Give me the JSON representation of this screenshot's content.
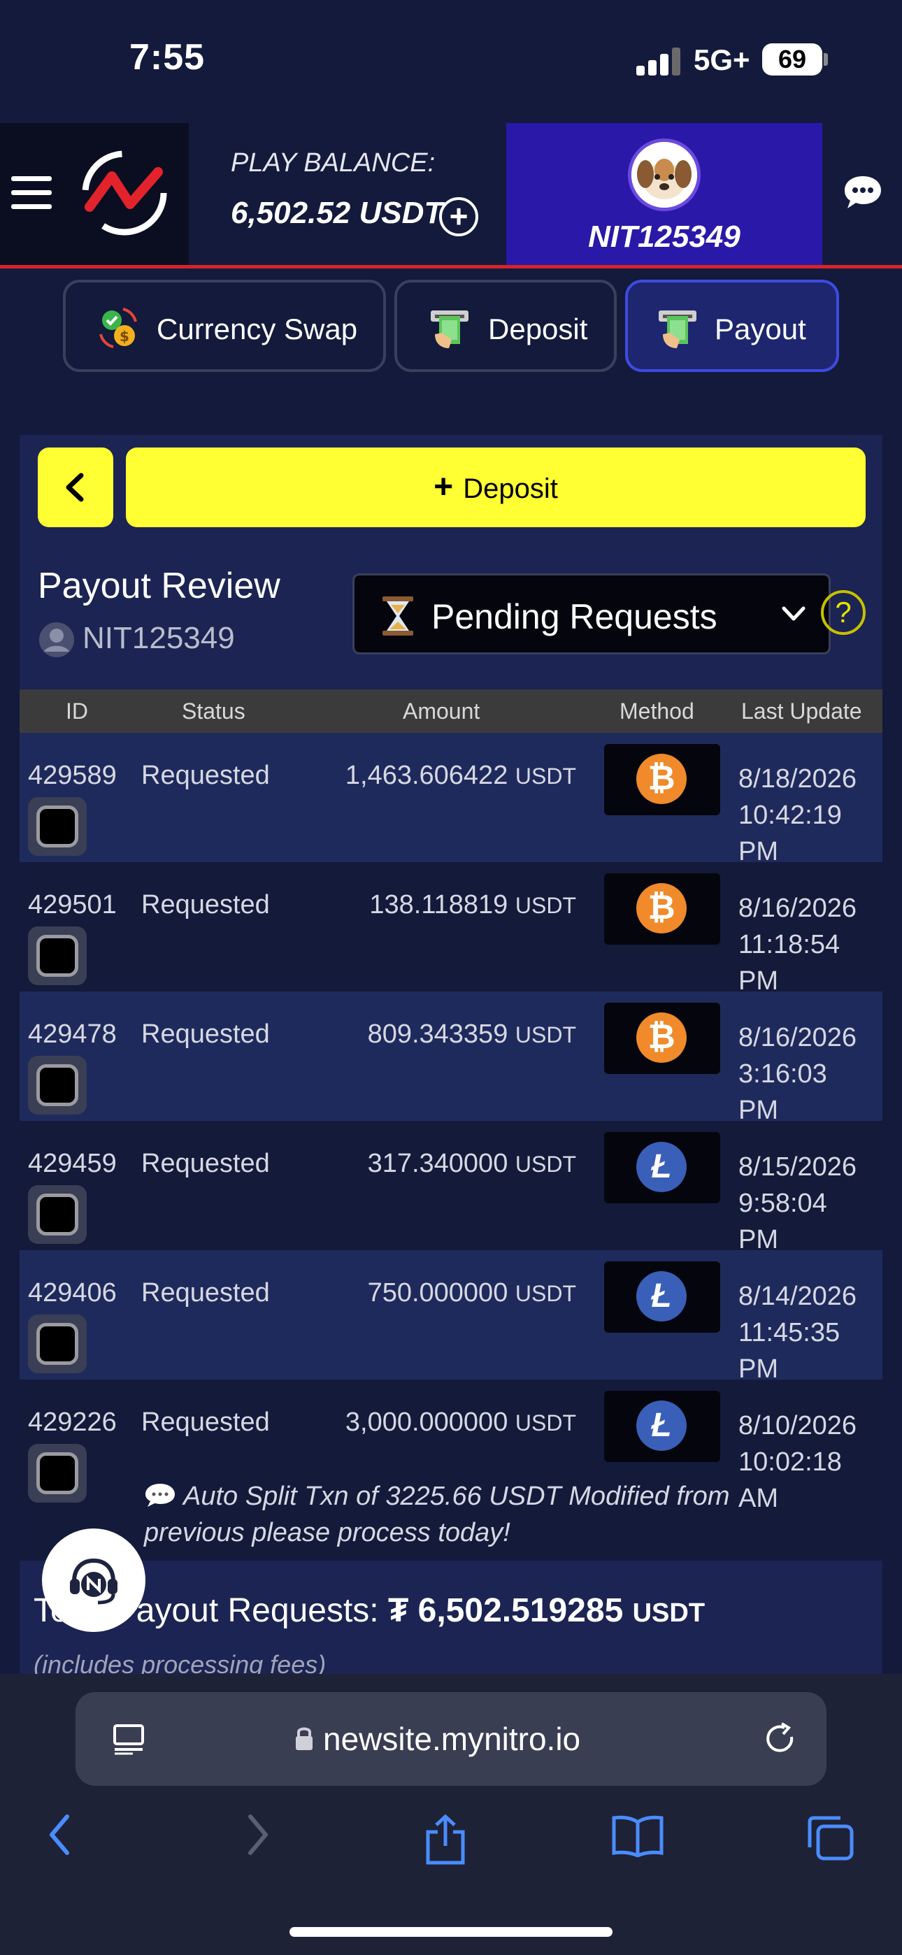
{
  "status_bar": {
    "time": "7:55",
    "network": "5G+",
    "battery": "69"
  },
  "header": {
    "balance_label": "PLAY BALANCE:",
    "balance_value": "6,502.52 USDT",
    "add_symbol": "+",
    "username": "NIT125349"
  },
  "tabs": [
    {
      "label": "Currency Swap",
      "icon": "currency-swap-icon",
      "active": false
    },
    {
      "label": "Deposit",
      "icon": "atm-cash-icon",
      "active": false
    },
    {
      "label": "Payout",
      "icon": "atm-cash-icon",
      "active": true
    }
  ],
  "actions": {
    "deposit_label": "Deposit",
    "deposit_plus": "+"
  },
  "review": {
    "title": "Payout Review",
    "user": "NIT125349",
    "filter_value": "Pending Requests",
    "help": "?"
  },
  "table": {
    "headers": [
      "ID",
      "Status",
      "Amount",
      "Method",
      "Last Update"
    ],
    "rows": [
      {
        "id": "429589",
        "status": "Requested",
        "amount": "1,463.606422",
        "unit": "USDT",
        "method": "bitcoin",
        "date": "8/18/2026",
        "time": "10:42:19",
        "ampm": "PM"
      },
      {
        "id": "429501",
        "status": "Requested",
        "amount": "138.118819",
        "unit": "USDT",
        "method": "bitcoin",
        "date": "8/16/2026",
        "time": "11:18:54",
        "ampm": "PM"
      },
      {
        "id": "429478",
        "status": "Requested",
        "amount": "809.343359",
        "unit": "USDT",
        "method": "bitcoin",
        "date": "8/16/2026",
        "time": "3:16:03",
        "ampm": "PM"
      },
      {
        "id": "429459",
        "status": "Requested",
        "amount": "317.340000",
        "unit": "USDT",
        "method": "litecoin",
        "date": "8/15/2026",
        "time": "9:58:04",
        "ampm": "PM"
      },
      {
        "id": "429406",
        "status": "Requested",
        "amount": "750.000000",
        "unit": "USDT",
        "method": "litecoin",
        "date": "8/14/2026",
        "time": "11:45:35",
        "ampm": "PM"
      },
      {
        "id": "429226",
        "status": "Requested",
        "amount": "3,000.000000",
        "unit": "USDT",
        "method": "litecoin",
        "date": "8/10/2026",
        "time": "10:02:18",
        "ampm": "AM"
      }
    ],
    "note": "Auto Split Txn of 3225.66 USDT Modified from previous please process today!"
  },
  "total": {
    "label": "Total Payout Requests:",
    "symbol": "₮",
    "amount": "6,502.519285",
    "unit": "USDT",
    "sub": "(includes processing fees)"
  },
  "browser": {
    "url": "newsite.mynitro.io"
  },
  "colors": {
    "accent_yellow": "#ffff33",
    "brand_red": "#d8232a",
    "user_block": "#2a18a8",
    "btc": "#f08a2a",
    "ltc": "#3a5fb8"
  }
}
